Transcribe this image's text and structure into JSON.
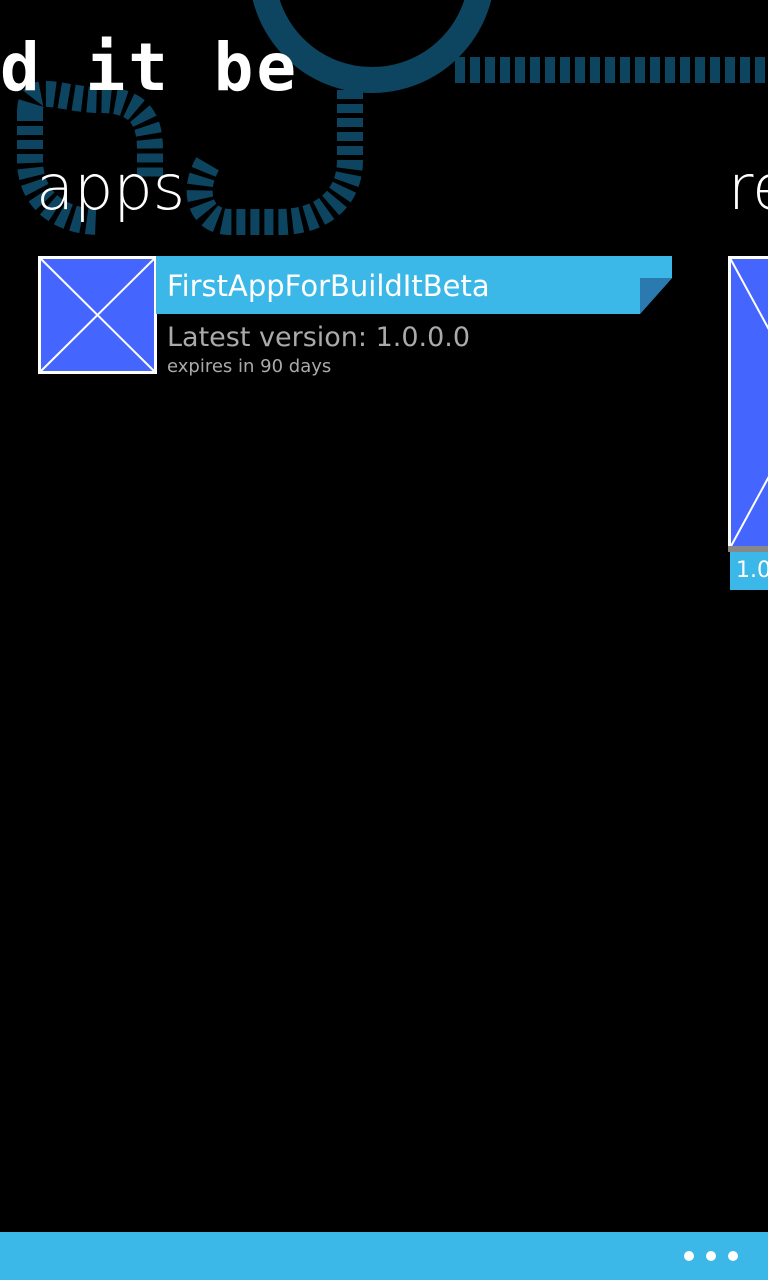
{
  "panorama": {
    "title": "d it beta"
  },
  "sections": {
    "apps": {
      "header": "apps"
    },
    "next": {
      "header": "re"
    }
  },
  "apps_list": [
    {
      "name": "FirstAppForBuildItBeta",
      "version": "Latest version: 1.0.0.0",
      "expires": "expires in 90 days"
    }
  ],
  "next_tile": {
    "badge": "1.0"
  },
  "app_bar": {
    "more_icon": "ellipsis-icon"
  },
  "colors": {
    "accent": "#3bb8e8",
    "tile_blue": "#4466ff",
    "background": "#000000",
    "bg_art": "#0e4a66",
    "secondary_text": "#aaaaaa"
  }
}
